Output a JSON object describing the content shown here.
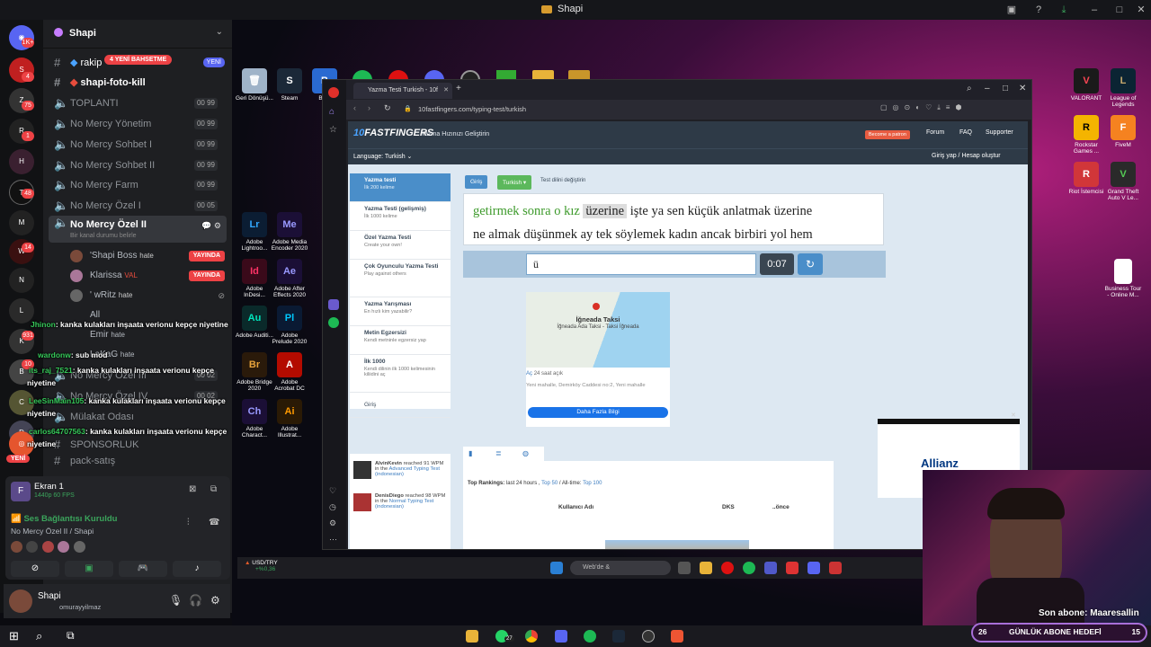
{
  "window": {
    "title": "Shapi"
  },
  "discord": {
    "server_name": "Shapi",
    "server_badges": [
      "1K+",
      "4",
      "75",
      "1",
      "48",
      "14",
      "931",
      "10"
    ],
    "channels": [
      {
        "type": "text",
        "name": "rakip",
        "tag": "YENİ"
      },
      {
        "type": "text",
        "name": "shapi-foto-kill"
      },
      {
        "type": "voice",
        "name": "TOPLANTI",
        "count": "00",
        "limit": "99"
      },
      {
        "type": "voice",
        "name": "No Mercy Yönetim",
        "count": "00",
        "limit": "99"
      },
      {
        "type": "voice",
        "name": "No Mercy Sohbet I",
        "count": "00",
        "limit": "99"
      },
      {
        "type": "voice",
        "name": "No Mercy Sohbet II",
        "count": "00",
        "limit": "99"
      },
      {
        "type": "voice",
        "name": "No Mercy Farm",
        "count": "00",
        "limit": "99"
      },
      {
        "type": "voice",
        "name": "No Mercy Özel I",
        "count": "00",
        "limit": "05"
      }
    ],
    "mention_badge": "4 YENİ BAHSETME",
    "active_channel": {
      "name": "No Mercy Özel II",
      "status": "Bir kanal durumu belirle"
    },
    "voice_users": [
      {
        "name": "'Shapi Boss",
        "tag": "hate",
        "live": "YAYINDA"
      },
      {
        "name": "Klarissa",
        "tag": "VAL",
        "live": "YAYINDA"
      },
      {
        "name": "' wRitz",
        "tag": "hate"
      }
    ],
    "lower_channels": [
      {
        "name": "All"
      },
      {
        "name": "Emir",
        "tag": "hate"
      },
      {
        "name": "LaKaG",
        "tag": "hate"
      },
      {
        "name": "No Mercy Özel III",
        "count": "00",
        "limit": "02"
      },
      {
        "name": "No Mercy Özel IV",
        "count": "00",
        "limit": "02"
      },
      {
        "name": "Mülakat Odası"
      },
      {
        "name": "SPONSORLUK"
      },
      {
        "name": "pack-satış"
      }
    ],
    "new_badge": "YENİ",
    "screen_share": {
      "title": "Ekran 1",
      "quality": "1440p 60 FPS"
    },
    "connection": {
      "status": "Ses Bağlantısı Kuruldu",
      "channel": "No Mercy Özel II / Shapi"
    },
    "user": {
      "name": "Shapi",
      "handle": "omurayyilmaz"
    }
  },
  "chat": [
    {
      "user": "Jhinon",
      "text": ": kanka kulakları inşaata verionu kepçe niyetine"
    },
    {
      "user": "wardonw",
      "text": ": sub mod"
    },
    {
      "user": "its_raj_7521",
      "text": ": kanka kulakları inşaata verionu kepçe"
    },
    {
      "user": "",
      "text": "niyetine"
    },
    {
      "user": "LeeSinMain105",
      "text": ": kanka kulakları inşaata verionu kepçe"
    },
    {
      "user": "",
      "text": "niyetine"
    },
    {
      "user": "carlos64707563",
      "text": ": kanka kulakları inşaata verionu kepçe"
    },
    {
      "user": "",
      "text": "niyetine"
    }
  ],
  "desktop_icons": {
    "top_row": [
      "Geri Dönüşü...",
      "Steam",
      "Ba..."
    ],
    "adobe": [
      {
        "label": "Adobe Lightroo...",
        "abbr": "Lr",
        "color": "#0b1d33"
      },
      {
        "label": "Adobe Media Encoder 2020",
        "abbr": "Me",
        "color": "#1b0f36"
      },
      {
        "label": "Adobe InDesi...",
        "abbr": "Id",
        "color": "#3a0a1a"
      },
      {
        "label": "Adobe After Effects 2020",
        "abbr": "Ae",
        "color": "#1b0f36"
      },
      {
        "label": "Adobe Auditi...",
        "abbr": "Au",
        "color": "#0a2a2a"
      },
      {
        "label": "Adobe Prelude 2020",
        "abbr": "Pl",
        "color": "#0a1a33"
      },
      {
        "label": "Adobe Bridge 2020",
        "abbr": "Br",
        "color": "#2a1a0a"
      },
      {
        "label": "Adobe Acrobat DC",
        "abbr": "A",
        "color": "#b30b00"
      },
      {
        "label": "Adobe Charact...",
        "abbr": "Ch",
        "color": "#1b0f36"
      },
      {
        "label": "Adobe Illustrat...",
        "abbr": "Ai",
        "color": "#2a1a05"
      }
    ],
    "right": [
      {
        "label": "VALORANT",
        "abbr": "V",
        "color": "#1a1a1a"
      },
      {
        "label": "League of Legends",
        "abbr": "L",
        "color": "#0b2433"
      },
      {
        "label": "Rockstar Games ...",
        "abbr": "R",
        "color": "#f4b400"
      },
      {
        "label": "FiveM",
        "abbr": "F",
        "color": "#f58220"
      },
      {
        "label": "Riot İstemcisi",
        "abbr": "R",
        "color": "#d13639"
      },
      {
        "label": "Grand Theft Auto V Le...",
        "abbr": "V",
        "color": "#2a2a2a"
      },
      {
        "label": "Business Tour - Online M...",
        "abbr": "",
        "color": "#ffffff"
      }
    ]
  },
  "browser": {
    "tab_title": "Yazma Testi Turkish - 10f",
    "url": "10fastfingers.com/typing-test/turkish"
  },
  "site": {
    "brand": "FASTFINGERS",
    "slogan": "Yazma Hızınızı Geliştirin",
    "patron": "Become a patron",
    "nav": [
      "Forum",
      "FAQ",
      "Supporter"
    ],
    "language": "Language: Turkish",
    "login": "Giriş yap / Hesap oluştur",
    "leftnav": [
      {
        "title": "Yazma testi",
        "sub": "İlk 200 kelime"
      },
      {
        "title": "Yazma Testi (gelişmiş)",
        "sub": "İlk 1000 kelime"
      },
      {
        "title": "Özel Yazma Testi",
        "sub": "Create your own!"
      },
      {
        "title": "Çok Oyunculu Yazma Testi",
        "sub": "Play against others"
      },
      {
        "title": "Yazma Yarışması",
        "sub": "En hızlı kim yazabilir?"
      },
      {
        "title": "Metin Egzersizi",
        "sub": "Kendi metninle egzersiz yap"
      },
      {
        "title": "İlk 1000",
        "sub": "Kendi dilinin ilk 1000 kelimesinin kiliidini aç"
      },
      {
        "title": "Giriş",
        "sub": ""
      }
    ],
    "buttons": {
      "login": "Giriş",
      "lang": "Turkish ▾",
      "change": "Test dilini değiştirin"
    },
    "typed_words": "getirmek sonra o kız",
    "current_word": "üzerine",
    "rest_line1": "işte ya sen küçük anlatmak üzerine",
    "line2": "ne almak düşünmek ay tek söylemek kadın ancak birbiri yol hem",
    "input_value": "ü",
    "timer": "0:07",
    "map": {
      "title": "İğneada Taksi",
      "subtitle": "İğneada Ada Taksi - Taksi İğneada",
      "open": "Aç",
      "hours": "24 saat açık",
      "address": "Yeni mahalle, Demirköy Caddesi no:2, Yeni mahalle",
      "button": "Daha Fazla Bilgi"
    },
    "rankings": {
      "label": "Top Rankings:",
      "periods": "last 24 hours ,",
      "top50": "Top 50",
      "alltime": " / All-time: ",
      "top100": "Top 100",
      "col_user": "Kullanıcı Adı",
      "col_dks": "DKS",
      "col_prev": "..önce"
    },
    "feed": [
      {
        "user": "AlvinKevin",
        "text": " reached 91 WPM in the ",
        "link": "Advanced Typing Test (indonesian)"
      },
      {
        "user": "DenisDiego",
        "text": " reached 98 WPM in the ",
        "link": "Normal Typing Test (indonesian)"
      }
    ]
  },
  "ad": {
    "brand": "Allianz"
  },
  "taskbar": {
    "ticker": {
      "pair": "USD/TRY",
      "change": "+%0,36"
    },
    "search": "Web'de &",
    "whatsapp_badge": "27"
  },
  "stream": {
    "last_sub_label": "Son abone: Maaresallin",
    "goal": {
      "current": "26",
      "label": "GÜNLÜK ABONE HEDEFİ",
      "target": "15"
    }
  }
}
